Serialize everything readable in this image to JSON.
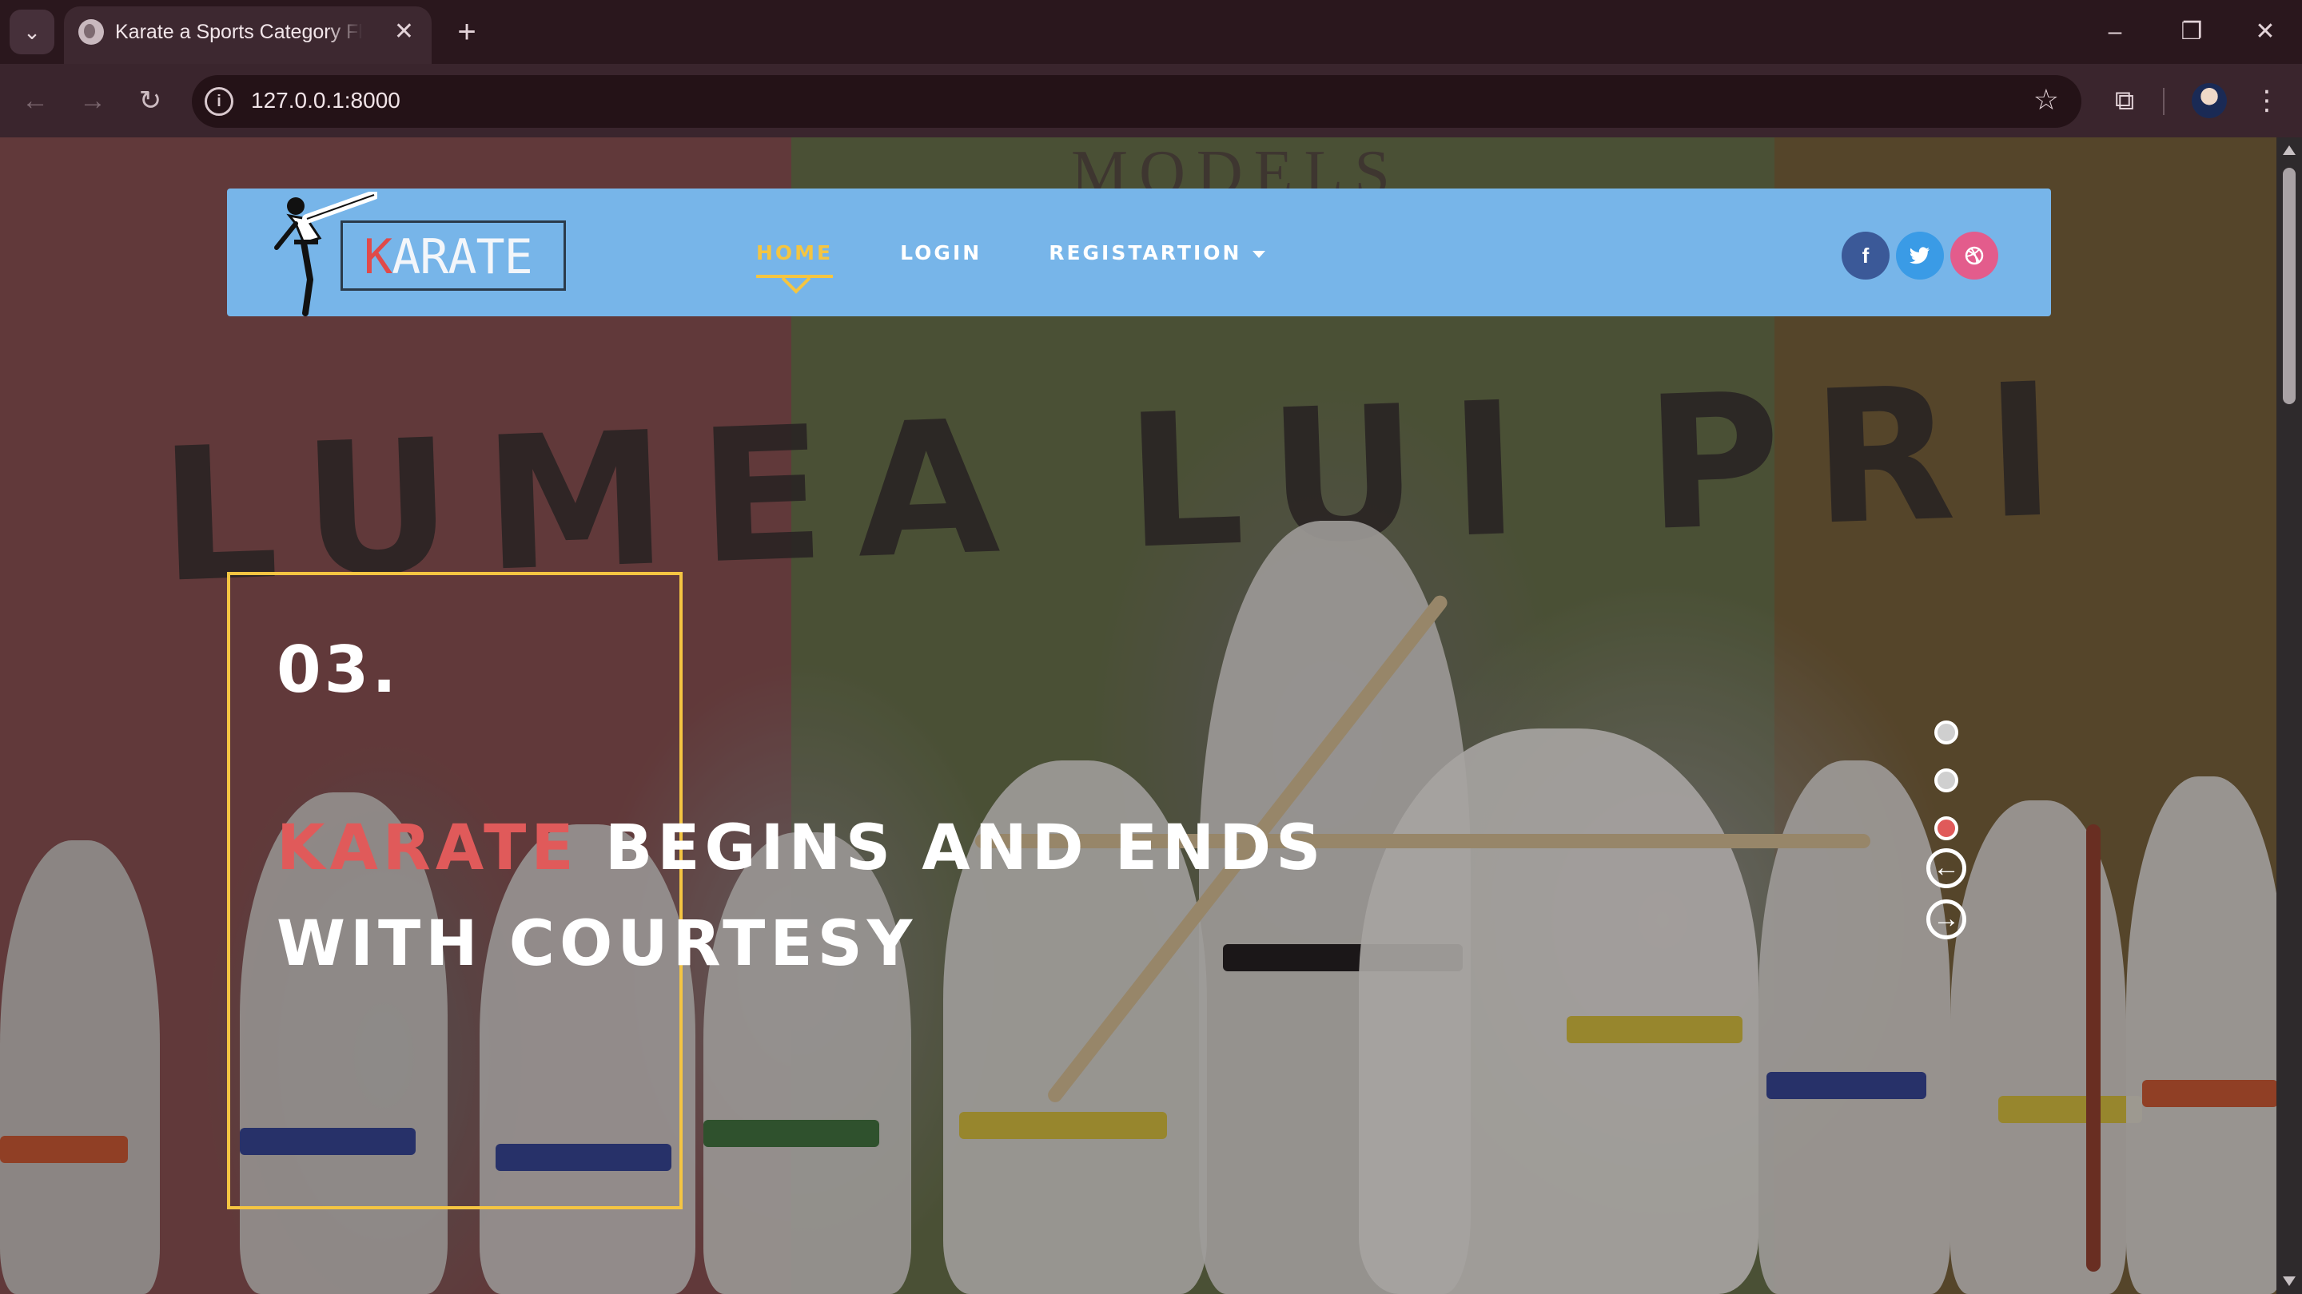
{
  "browser": {
    "tab_title": "Karate a Sports Category Flat Bootstrap Responsive Website Template",
    "url": "127.0.0.1:8000",
    "new_tab_symbol": "+",
    "tab_close_symbol": "✕"
  },
  "site": {
    "logo_first_letter": "K",
    "logo_rest": "ARATE",
    "nav": [
      {
        "label": "HOME",
        "active": true
      },
      {
        "label": "LOGIN",
        "active": false
      },
      {
        "label": "REGISTARTION",
        "active": false,
        "dropdown": true
      }
    ],
    "social": [
      {
        "name": "facebook-icon",
        "glyph": "f",
        "color": "#3b5998"
      },
      {
        "name": "twitter-icon",
        "glyph": "t",
        "color": "#3a9be6"
      },
      {
        "name": "dribbble-icon",
        "glyph": "⊛",
        "color": "#e35c8c"
      }
    ],
    "accent_color": "#f4c542",
    "highlight_color": "#e05a5a",
    "header_color": "#77b5e9"
  },
  "hero": {
    "number": "03.",
    "headline_highlight": "KARATE",
    "headline_line1_rest": " BEGINS AND ENDS",
    "headline_line2": "WITH COURTESY",
    "background_banner_text": "LUMEA LUI PRI",
    "background_top_text": "MODELS",
    "slider": {
      "slide_count": 3,
      "active_slide": 3
    }
  }
}
